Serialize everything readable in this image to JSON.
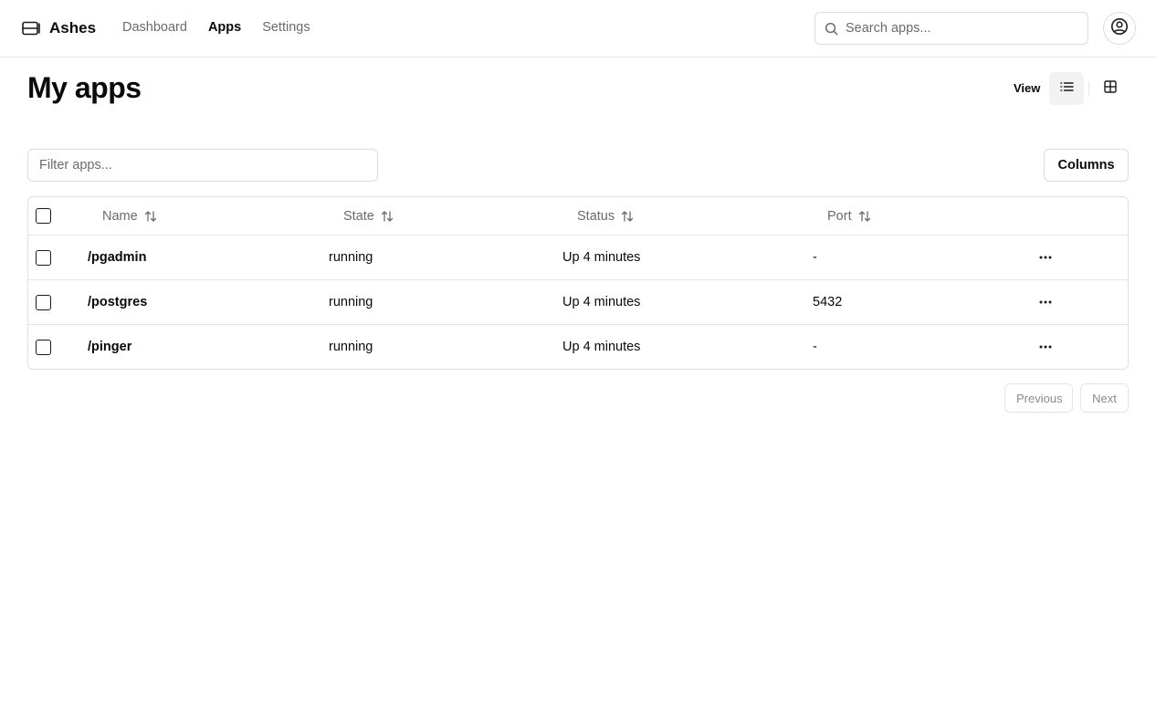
{
  "app": {
    "name": "Ashes",
    "logo_icon": "server-icon"
  },
  "nav": {
    "items": [
      {
        "label": "Dashboard",
        "active": false
      },
      {
        "label": "Apps",
        "active": true
      },
      {
        "label": "Settings",
        "active": false
      }
    ]
  },
  "search": {
    "placeholder": "Search apps...",
    "value": "",
    "icon": "search-icon"
  },
  "account": {
    "icon": "user-circle-icon"
  },
  "page": {
    "title": "My apps"
  },
  "view": {
    "label": "View",
    "options": [
      {
        "icon": "list-icon",
        "selected": true
      },
      {
        "icon": "grid-icon",
        "selected": false
      }
    ]
  },
  "filter": {
    "placeholder": "Filter apps...",
    "value": ""
  },
  "columns_button": {
    "label": "Columns"
  },
  "table": {
    "columns": [
      {
        "label": "Name",
        "sortable": true
      },
      {
        "label": "State",
        "sortable": true
      },
      {
        "label": "Status",
        "sortable": true
      },
      {
        "label": "Port",
        "sortable": true
      }
    ],
    "rows": [
      {
        "name": "/pgadmin",
        "state": "running",
        "status": "Up 4 minutes",
        "port": "-"
      },
      {
        "name": "/postgres",
        "state": "running",
        "status": "Up 4 minutes",
        "port": "5432"
      },
      {
        "name": "/pinger",
        "state": "running",
        "status": "Up 4 minutes",
        "port": "-"
      }
    ]
  },
  "pagination": {
    "previous_label": "Previous",
    "next_label": "Next"
  },
  "colors": {
    "text": "#0a0a0a",
    "muted": "#6b6b6b",
    "border": "#e5e5e5",
    "selected_bg": "#f2f2f2"
  }
}
